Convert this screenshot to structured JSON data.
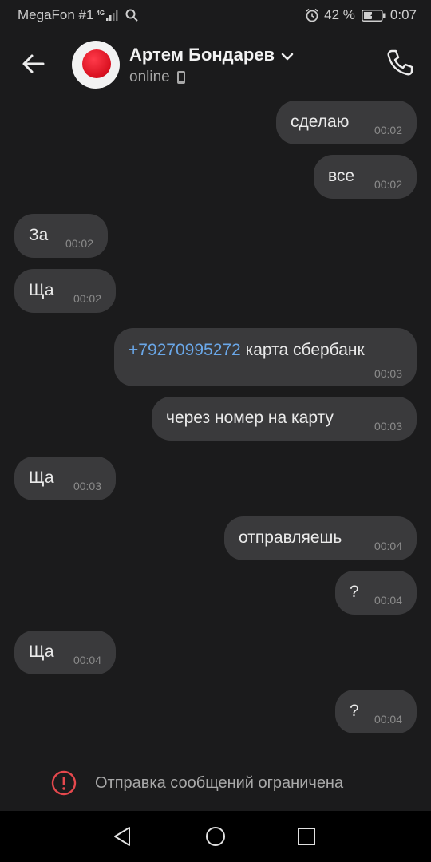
{
  "status_bar": {
    "carrier": "MegaFon #1",
    "network": "4G",
    "battery": "42 %",
    "time": "0:07"
  },
  "header": {
    "contact_name": "Артем Бондарев",
    "status": "online"
  },
  "messages": [
    {
      "side": "out",
      "text": "сделаю",
      "time": "00:02"
    },
    {
      "side": "out",
      "text": "все",
      "time": "00:02"
    },
    {
      "side": "in",
      "text": "За",
      "time": "00:02"
    },
    {
      "side": "in",
      "text": "Ща",
      "time": "00:02"
    },
    {
      "side": "out",
      "link": "+79270995272",
      "text": " карта сбербанк",
      "time": "00:03"
    },
    {
      "side": "out",
      "text": "через номер на карту",
      "time": "00:03"
    },
    {
      "side": "in",
      "text": "Ща",
      "time": "00:03"
    },
    {
      "side": "out",
      "text": "отправляешь",
      "time": "00:04"
    },
    {
      "side": "out",
      "text": "?",
      "time": "00:04"
    },
    {
      "side": "in",
      "text": "Ща",
      "time": "00:04"
    },
    {
      "side": "out",
      "text": "?",
      "time": "00:04"
    }
  ],
  "restriction": {
    "text": "Отправка сообщений ограничена"
  },
  "colors": {
    "background": "#1b1b1c",
    "bubble": "#3a3a3c",
    "link": "#6aa7e8",
    "alert": "#e5484d"
  }
}
